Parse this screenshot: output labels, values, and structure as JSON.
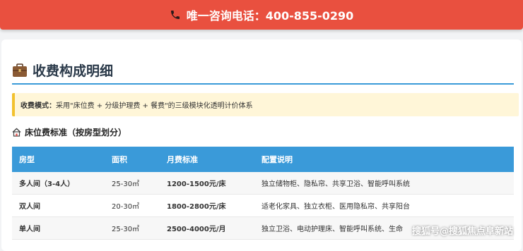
{
  "hotline": {
    "text": "唯一咨询电话：400-855-0290",
    "icon": "phone-icon"
  },
  "section": {
    "title": "收费构成明细",
    "icon": "briefcase-icon"
  },
  "notice": {
    "label": "收费模式：",
    "text": "采用\"床位费 + 分级护理费 + 餐费\"的三级模块化透明计价体系"
  },
  "bed_fee": {
    "title": "床位费标准（按房型划分）",
    "icon": "house-icon",
    "columns": [
      "房型",
      "面积",
      "月费标准",
      "配置说明"
    ],
    "rows": [
      {
        "type": "多人间（3-4人）",
        "area": "25-30㎡",
        "price": "1200-1500元/床",
        "config": "独立储物柜、隐私帘、共享卫浴、智能呼叫系统"
      },
      {
        "type": "双人间",
        "area": "20-30㎡",
        "price": "1800-2800元/床",
        "config": "适老化家具、独立衣柜、医用隐私帘、共享阳台"
      },
      {
        "type": "单人间",
        "area": "25-30㎡",
        "price": "2500-4000元/月",
        "config": "独立卫浴、电动护理床、智能呼叫系统、生命"
      }
    ]
  },
  "watermark": "搜狐号@搜狐焦点阜新站",
  "colors": {
    "hotline_bg": "#e9503f",
    "accent": "#3a9ad9",
    "price": "#e64b3c",
    "notice_bg": "#fff6d8",
    "notice_border": "#f2c12e"
  }
}
